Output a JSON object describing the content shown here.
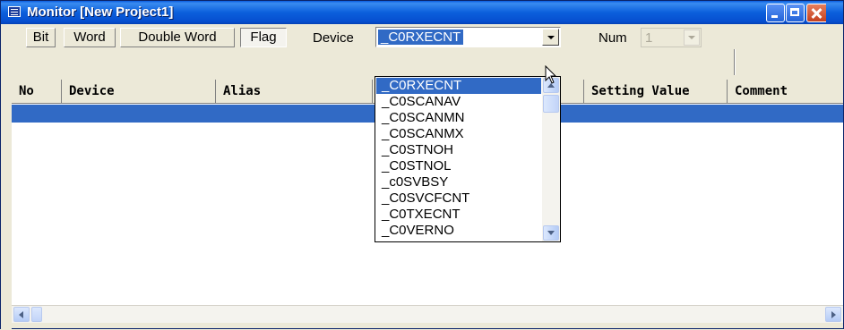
{
  "window": {
    "title": "Monitor [New Project1]"
  },
  "toolbar": {
    "modes": [
      "Bit",
      "Word",
      "Double Word",
      "Flag"
    ],
    "active_mode": "Flag",
    "device_label": "Device",
    "device_value": "_C0RXECNT",
    "num_label": "Num",
    "num_value": "1"
  },
  "table": {
    "columns": [
      "No",
      "Device",
      "Alias",
      "",
      "Setting Value",
      "Comment"
    ]
  },
  "device_dropdown": {
    "options": [
      "_C0RXECNT",
      "_C0SCANAV",
      "_C0SCANMN",
      "_C0SCANMX",
      "_C0STNOH",
      "_C0STNOL",
      "_c0SVBSY",
      "_C0SVCFCNT",
      "_C0TXECNT",
      "_C0VERNO"
    ],
    "selected_index": 0
  },
  "colors": {
    "selection": "#316ac5",
    "titlebar": "#0b5fdc",
    "face": "#ece9d8"
  }
}
